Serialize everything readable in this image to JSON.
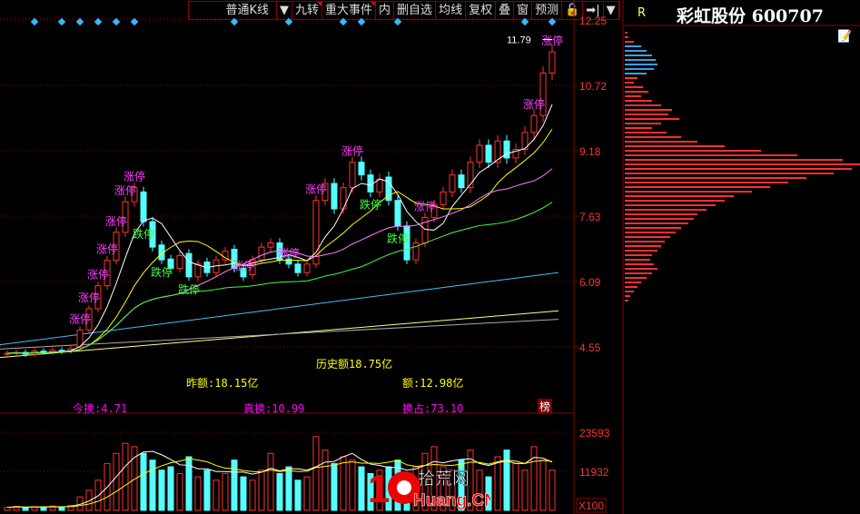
{
  "toolbar": {
    "items": [
      "普通K线",
      "▼",
      "九转",
      "重大事件",
      "内",
      "删自选",
      "均线",
      "复权",
      "叠",
      "窗",
      "预测",
      "🔓",
      "➡|",
      "▼"
    ]
  },
  "stock": {
    "flag": "R",
    "title": "彩虹股份 600707"
  },
  "colors": {
    "up": "#ff3232",
    "down": "#54ffff",
    "grid": "#8b0000",
    "axis": "#ff3232",
    "limit_up": "#ff40ff",
    "limit_down": "#40ff40"
  },
  "price_axis": {
    "ticks": [
      "12.25",
      "10.72",
      "9.18",
      "7.63",
      "6.09",
      "4.55"
    ],
    "max_label": "11.79"
  },
  "volume_axis": {
    "ticks": [
      "23593",
      "11932"
    ],
    "unit": "X100"
  },
  "stats": {
    "hist_amount": "历史额18.75亿",
    "prev_amount": "昨额:18.15亿",
    "amount": "额:12.98亿",
    "turnover_today": "今换:4.71",
    "turnover_real": "真换:10.99",
    "turnover_share": "换占:73.10",
    "rank_button": "榜"
  },
  "watermark": {
    "text": "10 拾荒网 Huang.CN"
  },
  "chart_data": {
    "type": "candlestick",
    "ylim": [
      4.55,
      12.25
    ],
    "open": [
      4.38,
      4.4,
      4.42,
      4.38,
      4.45,
      4.43,
      4.47,
      4.45,
      4.55,
      4.95,
      5.45,
      5.99,
      6.59,
      7.25,
      7.97,
      8.2,
      7.5,
      6.95,
      6.62,
      6.4,
      6.75,
      6.2,
      6.55,
      6.3,
      6.6,
      6.85,
      6.4,
      6.25,
      6.6,
      6.9,
      7.0,
      6.62,
      6.5,
      6.3,
      6.5,
      8.0,
      8.4,
      7.8,
      8.3,
      8.9,
      8.6,
      8.2,
      8.55,
      8.0,
      7.4,
      6.6,
      7.0,
      7.6,
      7.9,
      8.2,
      8.6,
      8.3,
      8.9,
      9.3,
      8.9,
      9.4,
      9.0,
      9.2,
      9.6,
      10.0,
      11.0
    ],
    "close": [
      4.4,
      4.42,
      4.38,
      4.45,
      4.43,
      4.47,
      4.45,
      4.5,
      4.95,
      5.45,
      5.99,
      6.59,
      7.25,
      7.97,
      8.3,
      7.5,
      6.9,
      6.6,
      6.4,
      6.7,
      6.2,
      6.5,
      6.3,
      6.6,
      6.8,
      6.4,
      6.2,
      6.6,
      6.9,
      7.0,
      6.6,
      6.5,
      6.3,
      6.5,
      8.0,
      8.4,
      7.8,
      8.3,
      8.9,
      8.6,
      8.2,
      8.5,
      8.0,
      7.4,
      6.6,
      7.0,
      7.6,
      7.9,
      8.2,
      8.6,
      8.3,
      8.9,
      9.3,
      8.9,
      9.4,
      9.0,
      9.2,
      9.6,
      10.0,
      11.0,
      11.5
    ],
    "volume": [
      900,
      1200,
      800,
      1100,
      1000,
      1300,
      1100,
      1500,
      4000,
      6000,
      9000,
      14000,
      17000,
      20000,
      19000,
      17000,
      15000,
      12000,
      13000,
      11000,
      16000,
      10000,
      12000,
      9000,
      11000,
      15000,
      10000,
      9000,
      12000,
      17000,
      11000,
      13000,
      9000,
      10000,
      22000,
      18000,
      14000,
      16000,
      15000,
      13000,
      11000,
      12000,
      13000,
      15000,
      9000,
      13000,
      17000,
      19000,
      13000,
      12000,
      15000,
      18000,
      12000,
      10000,
      16000,
      18000,
      14000,
      12000,
      19000,
      15000,
      12000
    ],
    "long_ma": [
      {
        "color": "#40c0ff",
        "from": 4.6,
        "to": 6.3
      },
      {
        "color": "#ffff80",
        "from": 4.3,
        "to": 5.4
      },
      {
        "color": "#aaaaaa",
        "from": 4.5,
        "to": 5.2
      }
    ],
    "ma_colors": [
      "#ffffff",
      "#ffff00",
      "#ff80ff",
      "#40ff40"
    ],
    "labels": [
      {
        "i": 14,
        "text": "涨停",
        "up": true
      },
      {
        "i": 13,
        "text": "涨停",
        "up": true
      },
      {
        "i": 12,
        "text": "涨停",
        "up": true
      },
      {
        "i": 11,
        "text": "涨停",
        "up": true
      },
      {
        "i": 10,
        "text": "涨停",
        "up": true
      },
      {
        "i": 9,
        "text": "涨停",
        "up": true
      },
      {
        "i": 8,
        "text": "涨停",
        "up": true
      },
      {
        "i": 15,
        "text": "跌停",
        "up": false
      },
      {
        "i": 17,
        "text": "跌停",
        "up": false
      },
      {
        "i": 20,
        "text": "跌停",
        "up": false
      },
      {
        "i": 26,
        "text": "涨停",
        "up": true
      },
      {
        "i": 31,
        "text": "涨停",
        "up": true
      },
      {
        "i": 34,
        "text": "涨停",
        "up": true
      },
      {
        "i": 38,
        "text": "涨停",
        "up": true
      },
      {
        "i": 40,
        "text": "跌停",
        "up": false
      },
      {
        "i": 43,
        "text": "跌停",
        "up": false
      },
      {
        "i": 46,
        "text": "涨停",
        "up": true
      },
      {
        "i": 58,
        "text": "涨停",
        "up": true
      },
      {
        "i": 60,
        "text": "涨停",
        "up": true
      }
    ],
    "event_markers": [
      3,
      6,
      8,
      10,
      12,
      14,
      25,
      31,
      37,
      39,
      43,
      57,
      60
    ]
  },
  "chip_distribution": [
    3,
    4,
    10,
    18,
    24,
    30,
    34,
    36,
    32,
    24,
    14,
    10,
    20,
    26,
    18,
    30,
    40,
    52,
    48,
    60,
    40,
    30,
    46,
    62,
    80,
    110,
    150,
    190,
    240,
    260,
    250,
    230,
    200,
    180,
    160,
    140,
    120,
    110,
    100,
    90,
    80,
    76,
    70,
    62,
    56,
    50,
    44,
    40,
    36,
    30,
    28,
    32,
    36,
    30,
    24,
    18,
    14,
    10,
    6,
    4
  ]
}
